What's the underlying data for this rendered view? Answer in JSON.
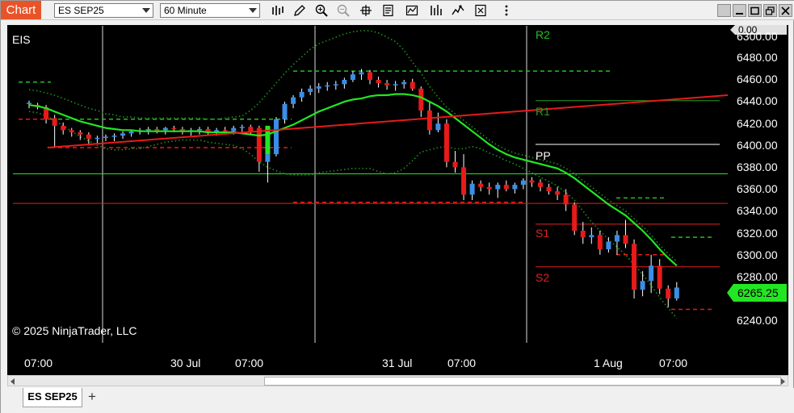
{
  "toolbar": {
    "chart_tab": "Chart",
    "instrument_select": "ES SEP25",
    "interval_select": "60 Minute",
    "tools": [
      "bar-type-icon",
      "draw-pencil-icon",
      "zoom-in-icon",
      "zoom-out-icon",
      "crosshair-icon",
      "data-box-icon",
      "indicators-icon",
      "strategies-icon",
      "templates-icon",
      "properties-icon"
    ],
    "window_buttons": [
      "restore-icon",
      "minimize-icon",
      "maximize-icon",
      "close-icon"
    ]
  },
  "chart": {
    "instrument_label": "EIS",
    "copyright": "© 2025 NinjaTrader, LLC",
    "last_price": "6265.25",
    "top_badge": "0.00",
    "price_ticks": [
      "6300.00",
      "6480.00",
      "6460.00",
      "6440.00",
      "6420.00",
      "6400.00",
      "6380.00",
      "6360.00",
      "6340.00",
      "6320.00",
      "6300.00",
      "6280.00",
      "6240.00"
    ],
    "time_ticks": [
      "07:00",
      "30 Jul",
      "07:00",
      "31 Jul",
      "07:00",
      "1 Aug",
      "07:00"
    ],
    "pivots": [
      {
        "label": "R2",
        "color": "#22c022"
      },
      {
        "label": "R1",
        "color": "#22a022"
      },
      {
        "label": "PP",
        "color": "#ffffff"
      },
      {
        "label": "S1",
        "color": "#e02020"
      },
      {
        "label": "S2",
        "color": "#e02020"
      }
    ],
    "colors": {
      "up": "#3a8ee8",
      "down": "#e81a1a",
      "ma": "#22e622",
      "trend": "#e81a1a",
      "band": "#1f8f1f"
    }
  },
  "chart_data": {
    "type": "candlestick",
    "symbol": "ES SEP25",
    "interval": "60 Minute",
    "ylim": [
      6230,
      6505
    ],
    "y_ticks": [
      6240,
      6280,
      6300,
      6320,
      6340,
      6360,
      6380,
      6400,
      6420,
      6440,
      6460,
      6480
    ],
    "candles": [
      [
        6438,
        6441,
        6434,
        6439
      ],
      [
        6437,
        6439,
        6433,
        6435
      ],
      [
        6435,
        6437,
        6420,
        6424
      ],
      [
        6425,
        6428,
        6398,
        6418
      ],
      [
        6418,
        6421,
        6410,
        6414
      ],
      [
        6414,
        6416,
        6408,
        6412
      ],
      [
        6412,
        6414,
        6405,
        6410
      ],
      [
        6410,
        6412,
        6400,
        6406
      ],
      [
        6406,
        6409,
        6402,
        6407
      ],
      [
        6407,
        6410,
        6404,
        6408
      ],
      [
        6408,
        6411,
        6404,
        6409
      ],
      [
        6409,
        6413,
        6406,
        6411
      ],
      [
        6411,
        6414,
        6408,
        6413
      ],
      [
        6413,
        6416,
        6410,
        6414
      ],
      [
        6414,
        6417,
        6410,
        6415
      ],
      [
        6415,
        6417,
        6411,
        6414
      ],
      [
        6414,
        6417,
        6410,
        6416
      ],
      [
        6416,
        6418,
        6412,
        6415
      ],
      [
        6415,
        6417,
        6410,
        6413
      ],
      [
        6413,
        6416,
        6409,
        6414
      ],
      [
        6414,
        6417,
        6410,
        6415
      ],
      [
        6415,
        6417,
        6410,
        6412
      ],
      [
        6412,
        6416,
        6409,
        6414
      ],
      [
        6414,
        6417,
        6410,
        6413
      ],
      [
        6413,
        6418,
        6410,
        6416
      ],
      [
        6416,
        6419,
        6412,
        6417
      ],
      [
        6417,
        6419,
        6410,
        6412
      ],
      [
        6416,
        6418,
        6376,
        6385
      ],
      [
        6385,
        6404,
        6366,
        6392
      ],
      [
        6392,
        6426,
        6390,
        6424
      ],
      [
        6424,
        6440,
        6420,
        6438
      ],
      [
        6438,
        6446,
        6434,
        6444
      ],
      [
        6444,
        6452,
        6440,
        6449
      ],
      [
        6449,
        6455,
        6446,
        6452
      ],
      [
        6452,
        6457,
        6448,
        6454
      ],
      [
        6454,
        6458,
        6450,
        6455
      ],
      [
        6455,
        6459,
        6451,
        6456
      ],
      [
        6456,
        6462,
        6452,
        6460
      ],
      [
        6460,
        6468,
        6458,
        6465
      ],
      [
        6465,
        6470,
        6460,
        6467
      ],
      [
        6467,
        6469,
        6456,
        6460
      ],
      [
        6460,
        6463,
        6453,
        6457
      ],
      [
        6457,
        6460,
        6451,
        6455
      ],
      [
        6455,
        6459,
        6450,
        6456
      ],
      [
        6456,
        6460,
        6452,
        6458
      ],
      [
        6458,
        6461,
        6450,
        6452
      ],
      [
        6452,
        6454,
        6426,
        6432
      ],
      [
        6432,
        6440,
        6410,
        6414
      ],
      [
        6414,
        6430,
        6412,
        6420
      ],
      [
        6420,
        6424,
        6380,
        6385
      ],
      [
        6385,
        6395,
        6375,
        6380
      ],
      [
        6380,
        6392,
        6350,
        6355
      ],
      [
        6355,
        6368,
        6350,
        6365
      ],
      [
        6365,
        6368,
        6358,
        6362
      ],
      [
        6362,
        6366,
        6355,
        6360
      ],
      [
        6360,
        6366,
        6352,
        6364
      ],
      [
        6364,
        6368,
        6358,
        6360
      ],
      [
        6360,
        6366,
        6356,
        6364
      ],
      [
        6364,
        6370,
        6360,
        6368
      ],
      [
        6368,
        6371,
        6362,
        6366
      ],
      [
        6366,
        6369,
        6358,
        6362
      ],
      [
        6362,
        6365,
        6355,
        6358
      ],
      [
        6358,
        6362,
        6350,
        6355
      ],
      [
        6355,
        6360,
        6340,
        6346
      ],
      [
        6346,
        6348,
        6318,
        6322
      ],
      [
        6322,
        6330,
        6310,
        6316
      ],
      [
        6316,
        6325,
        6310,
        6318
      ],
      [
        6318,
        6322,
        6300,
        6305
      ],
      [
        6305,
        6316,
        6302,
        6312
      ],
      [
        6312,
        6322,
        6300,
        6318
      ],
      [
        6318,
        6332,
        6306,
        6310
      ],
      [
        6310,
        6314,
        6260,
        6268
      ],
      [
        6268,
        6285,
        6262,
        6276
      ],
      [
        6276,
        6300,
        6265,
        6290
      ],
      [
        6290,
        6296,
        6264,
        6269
      ],
      [
        6269,
        6272,
        6252,
        6260
      ],
      [
        6260,
        6275,
        6258,
        6270
      ]
    ],
    "moving_average": [
      6437,
      6436,
      6434,
      6431,
      6428,
      6425,
      6422,
      6420,
      6418,
      6416,
      6415,
      6414,
      6414,
      6413,
      6413,
      6413,
      6413,
      6413,
      6413,
      6413,
      6413,
      6412,
      6412,
      6412,
      6412,
      6411,
      6410,
      6409,
      6410,
      6413,
      6416,
      6419,
      6423,
      6427,
      6431,
      6434,
      6437,
      6440,
      6442,
      6443,
      6445,
      6446,
      6446,
      6447,
      6447,
      6446,
      6444,
      6440,
      6436,
      6431,
      6425,
      6419,
      6413,
      6407,
      6401,
      6396,
      6392,
      6389,
      6387,
      6385,
      6383,
      6381,
      6379,
      6375,
      6370,
      6364,
      6358,
      6352,
      6346,
      6341,
      6336,
      6329,
      6322,
      6314,
      6305,
      6297,
      6290
    ],
    "trend_line": {
      "start": [
        5,
        6398
      ],
      "end": [
        80,
        6446
      ]
    },
    "pivot_levels": {
      "session1": {
        "top": 6458,
        "pp": 6424,
        "low": 6398
      },
      "session2": {
        "r": 6468,
        "pp": 6348
      },
      "session3": {
        "R2": 6468,
        "R1": 6441,
        "PP": 6401,
        "S1": 6328,
        "S2": 6289
      }
    },
    "horizontal_lines": [
      {
        "value": 6374,
        "color": "#22e622"
      },
      {
        "value": 6347,
        "color": "#e81a1a"
      }
    ]
  }
}
